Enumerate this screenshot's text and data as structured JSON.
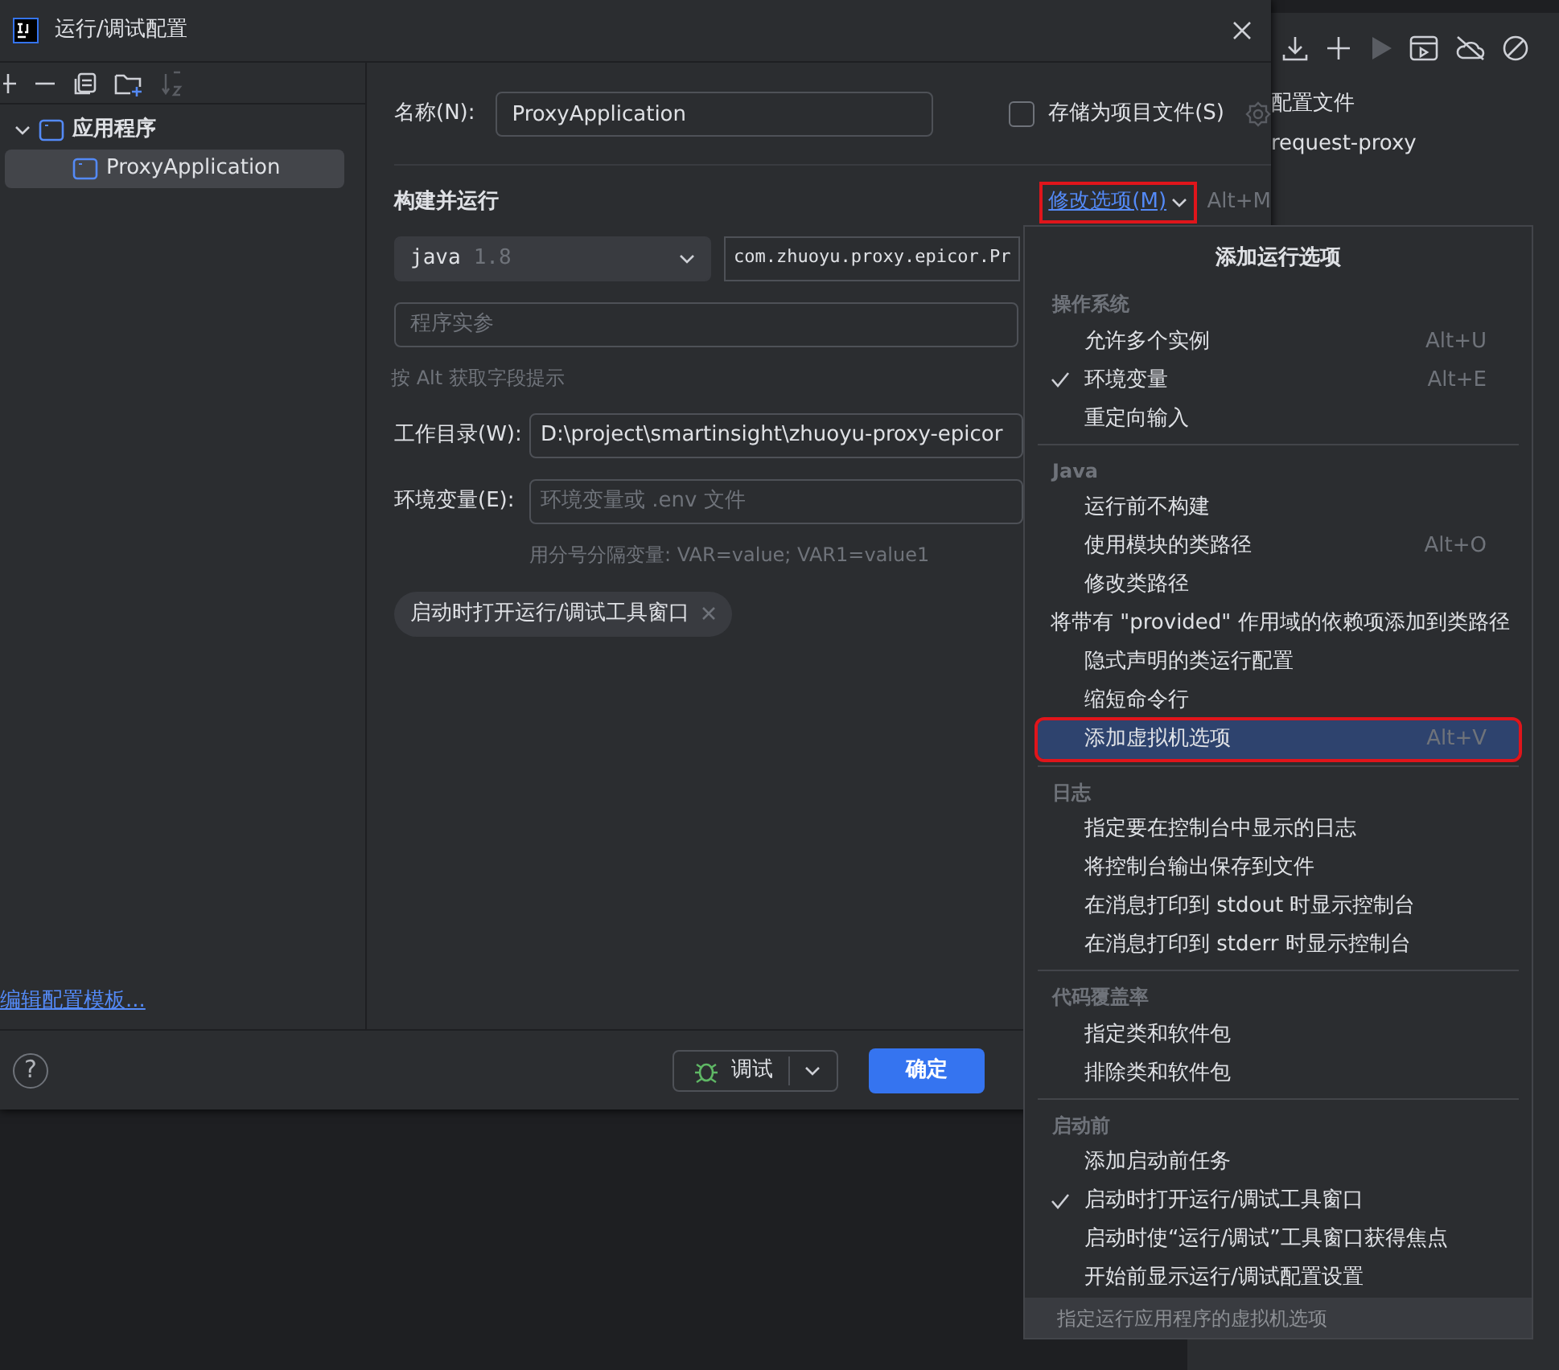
{
  "ide_panel": {
    "texts": [
      "配置文件",
      "request-proxy"
    ]
  },
  "dialog": {
    "title": "运行/调试配置",
    "tree": [
      {
        "label": "应用程序",
        "expanded": true,
        "selected": false,
        "children": [
          {
            "label": "ProxyApplication",
            "selected": true
          }
        ]
      }
    ],
    "edit_templates_link": "编辑配置模板...",
    "help": "?",
    "name_label": "名称(N):",
    "name_value": "ProxyApplication",
    "store_as_file": {
      "label": "存储为项目文件(S)",
      "checked": false
    },
    "section_title": "构建并运行",
    "modify_options": {
      "label": "修改选项(M)",
      "shortcut": "Alt+M",
      "annotated": true
    },
    "jdk": {
      "name": "java",
      "version": "1.8"
    },
    "main_class": "com.zhuoyu.proxy.epicor.Pr",
    "program_args": {
      "placeholder": "程序实参"
    },
    "field_hint": "按 Alt 获取字段提示",
    "working_dir": {
      "label": "工作目录(W):",
      "value": "D:\\project\\smartinsight\\zhuoyu-proxy-epicor"
    },
    "env": {
      "label": "环境变量(E):",
      "placeholder": "环境变量或 .env 文件",
      "hint": "用分号分隔变量: VAR=value; VAR1=value1"
    },
    "chips": [
      {
        "label": "启动时打开运行/调试工具窗口"
      }
    ],
    "buttons": [
      {
        "kind": "debug",
        "label": "调试"
      },
      {
        "kind": "primary",
        "label": "确定"
      }
    ]
  },
  "popup": {
    "title": "添加运行选项",
    "groups": [
      {
        "header": "操作系统",
        "items": [
          {
            "label": "允许多个实例",
            "shortcut": "Alt+U",
            "checked": false,
            "selected": false
          },
          {
            "label": "环境变量",
            "shortcut": "Alt+E",
            "checked": true,
            "selected": false
          },
          {
            "label": "重定向输入",
            "checked": false,
            "selected": false
          }
        ]
      },
      {
        "header": "Java",
        "items": [
          {
            "label": "运行前不构建",
            "checked": false,
            "selected": false
          },
          {
            "label": "使用模块的类路径",
            "shortcut": "Alt+O",
            "checked": false,
            "selected": false
          },
          {
            "label": "修改类路径",
            "checked": false,
            "selected": false
          },
          {
            "label": "将带有 \"provided\" 作用域的依赖项添加到类路径",
            "checked": false,
            "selected": false
          },
          {
            "label": "隐式声明的类运行配置",
            "checked": false,
            "selected": false
          },
          {
            "label": "缩短命令行",
            "checked": false,
            "selected": false
          },
          {
            "label": "添加虚拟机选项",
            "shortcut": "Alt+V",
            "checked": false,
            "selected": true,
            "annotated": true
          }
        ]
      },
      {
        "header": "日志",
        "items": [
          {
            "label": "指定要在控制台中显示的日志",
            "checked": false,
            "selected": false
          },
          {
            "label": "将控制台输出保存到文件",
            "checked": false,
            "selected": false
          },
          {
            "label": "在消息打印到 stdout 时显示控制台",
            "checked": false,
            "selected": false
          },
          {
            "label": "在消息打印到 stderr 时显示控制台",
            "checked": false,
            "selected": false
          }
        ]
      },
      {
        "header": "代码覆盖率",
        "items": [
          {
            "label": "指定类和软件包",
            "checked": false,
            "selected": false
          },
          {
            "label": "排除类和软件包",
            "checked": false,
            "selected": false
          }
        ]
      },
      {
        "header": "启动前",
        "items": [
          {
            "label": "添加启动前任务",
            "checked": false,
            "selected": false
          },
          {
            "label": "启动时打开运行/调试工具窗口",
            "checked": true,
            "selected": false
          },
          {
            "label": "启动时使“运行/调试”工具窗口获得焦点",
            "checked": false,
            "selected": false
          },
          {
            "label": "开始前显示运行/调试配置设置",
            "checked": false,
            "selected": false
          }
        ]
      }
    ],
    "footer": "指定运行应用程序的虚拟机选项"
  }
}
